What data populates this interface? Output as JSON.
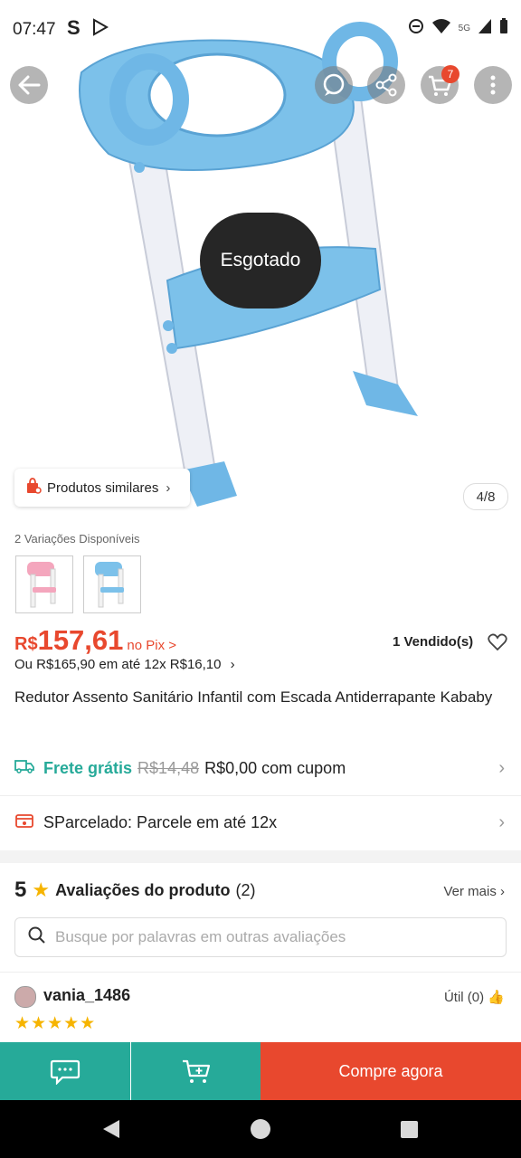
{
  "status_bar": {
    "time": "07:47",
    "app_letter": "S",
    "network": "5G"
  },
  "header": {
    "cart_count": "7"
  },
  "product_image": {
    "soldout_label": "Esgotado",
    "similar_label": "Produtos similares",
    "page_indicator": "4/8"
  },
  "variations": {
    "title": "2 Variações Disponíveis"
  },
  "price": {
    "currency": "R$",
    "value": "157,61",
    "pix_label": "no Pix >",
    "sold_label": "1 Vendido(s)",
    "installment": "Ou R$165,90 em até 12x R$16,10"
  },
  "product": {
    "name": "Redutor Assento Sanitário Infantil com Escada Antiderrapante Kababy"
  },
  "shipping": {
    "label": "Frete grátis",
    "old_price": "R$14,48",
    "new_price": "R$0,00 com cupom"
  },
  "parcelado": {
    "label": "SParcelado: Parcele em até 12x"
  },
  "reviews": {
    "rating": "5",
    "title": "Avaliações do produto",
    "count": "(2)",
    "see_more": "Ver mais",
    "search_placeholder": "Busque por palavras em outras avaliações"
  },
  "review": {
    "user": "vania_1486",
    "useful": "Útil (0)",
    "stars": "★★★★★"
  },
  "bottom": {
    "buy_label": "Compre agora"
  },
  "colors": {
    "accent_orange": "#e8482e",
    "teal": "#26aa99",
    "star": "#f6b400"
  }
}
